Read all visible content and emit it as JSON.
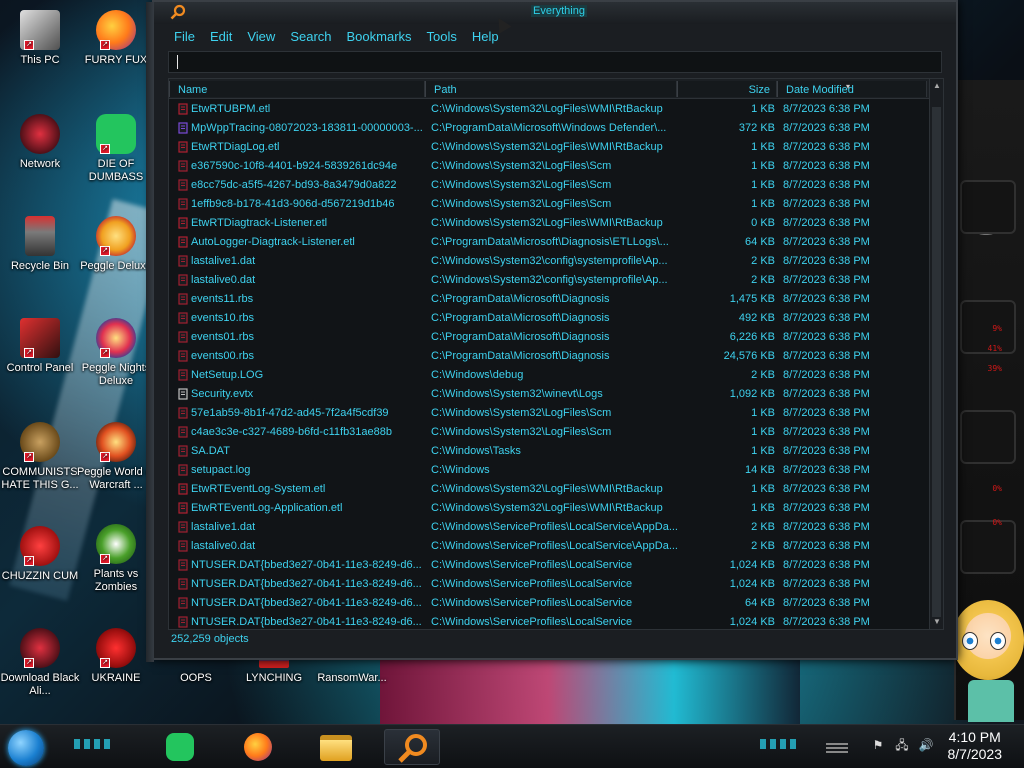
{
  "window": {
    "title": "Everything",
    "menu": [
      "File",
      "Edit",
      "View",
      "Search",
      "Bookmarks",
      "Tools",
      "Help"
    ],
    "search": {
      "value": "",
      "placeholder": ""
    },
    "columns": {
      "name": "Name",
      "path": "Path",
      "size": "Size",
      "date": "Date Modified"
    },
    "rows": [
      {
        "name": "EtwRTUBPM.etl",
        "path": "C:\\Windows\\System32\\LogFiles\\WMI\\RtBackup",
        "size": "1 KB",
        "date": "8/7/2023 6:38 PM",
        "icon": "etl-file-icon"
      },
      {
        "name": "MpWppTracing-08072023-183811-00000003-...",
        "path": "C:\\ProgramData\\Microsoft\\Windows Defender\\...",
        "size": "372 KB",
        "date": "8/7/2023 6:38 PM",
        "icon": "defender-file-icon"
      },
      {
        "name": "EtwRTDiagLog.etl",
        "path": "C:\\Windows\\System32\\LogFiles\\WMI\\RtBackup",
        "size": "1 KB",
        "date": "8/7/2023 6:38 PM",
        "icon": "etl-file-icon"
      },
      {
        "name": "e367590c-10f8-4401-b924-5839261dc94e",
        "path": "C:\\Windows\\System32\\LogFiles\\Scm",
        "size": "1 KB",
        "date": "8/7/2023 6:38 PM",
        "icon": "file-icon"
      },
      {
        "name": "e8cc75dc-a5f5-4267-bd93-8a3479d0a822",
        "path": "C:\\Windows\\System32\\LogFiles\\Scm",
        "size": "1 KB",
        "date": "8/7/2023 6:38 PM",
        "icon": "file-icon"
      },
      {
        "name": "1effb9c8-b178-41d3-906d-d567219d1b46",
        "path": "C:\\Windows\\System32\\LogFiles\\Scm",
        "size": "1 KB",
        "date": "8/7/2023 6:38 PM",
        "icon": "file-icon"
      },
      {
        "name": "EtwRTDiagtrack-Listener.etl",
        "path": "C:\\Windows\\System32\\LogFiles\\WMI\\RtBackup",
        "size": "0 KB",
        "date": "8/7/2023 6:38 PM",
        "icon": "etl-file-icon"
      },
      {
        "name": "AutoLogger-Diagtrack-Listener.etl",
        "path": "C:\\ProgramData\\Microsoft\\Diagnosis\\ETLLogs\\...",
        "size": "64 KB",
        "date": "8/7/2023 6:38 PM",
        "icon": "etl-file-icon"
      },
      {
        "name": "lastalive1.dat",
        "path": "C:\\Windows\\System32\\config\\systemprofile\\Ap...",
        "size": "2 KB",
        "date": "8/7/2023 6:38 PM",
        "icon": "file-icon"
      },
      {
        "name": "lastalive0.dat",
        "path": "C:\\Windows\\System32\\config\\systemprofile\\Ap...",
        "size": "2 KB",
        "date": "8/7/2023 6:38 PM",
        "icon": "file-icon"
      },
      {
        "name": "events11.rbs",
        "path": "C:\\ProgramData\\Microsoft\\Diagnosis",
        "size": "1,475 KB",
        "date": "8/7/2023 6:38 PM",
        "icon": "file-icon"
      },
      {
        "name": "events10.rbs",
        "path": "C:\\ProgramData\\Microsoft\\Diagnosis",
        "size": "492 KB",
        "date": "8/7/2023 6:38 PM",
        "icon": "file-icon"
      },
      {
        "name": "events01.rbs",
        "path": "C:\\ProgramData\\Microsoft\\Diagnosis",
        "size": "6,226 KB",
        "date": "8/7/2023 6:38 PM",
        "icon": "file-icon"
      },
      {
        "name": "events00.rbs",
        "path": "C:\\ProgramData\\Microsoft\\Diagnosis",
        "size": "24,576 KB",
        "date": "8/7/2023 6:38 PM",
        "icon": "file-icon"
      },
      {
        "name": "NetSetup.LOG",
        "path": "C:\\Windows\\debug",
        "size": "2 KB",
        "date": "8/7/2023 6:38 PM",
        "icon": "file-icon"
      },
      {
        "name": "Security.evtx",
        "path": "C:\\Windows\\System32\\winevt\\Logs",
        "size": "1,092 KB",
        "date": "8/7/2023 6:38 PM",
        "icon": "evtx-file-icon"
      },
      {
        "name": "57e1ab59-8b1f-47d2-ad45-7f2a4f5cdf39",
        "path": "C:\\Windows\\System32\\LogFiles\\Scm",
        "size": "1 KB",
        "date": "8/7/2023 6:38 PM",
        "icon": "file-icon"
      },
      {
        "name": "c4ae3c3e-c327-4689-b6fd-c11fb31ae88b",
        "path": "C:\\Windows\\System32\\LogFiles\\Scm",
        "size": "1 KB",
        "date": "8/7/2023 6:38 PM",
        "icon": "file-icon"
      },
      {
        "name": "SA.DAT",
        "path": "C:\\Windows\\Tasks",
        "size": "1 KB",
        "date": "8/7/2023 6:38 PM",
        "icon": "file-icon"
      },
      {
        "name": "setupact.log",
        "path": "C:\\Windows",
        "size": "14 KB",
        "date": "8/7/2023 6:38 PM",
        "icon": "file-icon"
      },
      {
        "name": "EtwRTEventLog-System.etl",
        "path": "C:\\Windows\\System32\\LogFiles\\WMI\\RtBackup",
        "size": "1 KB",
        "date": "8/7/2023 6:38 PM",
        "icon": "etl-file-icon"
      },
      {
        "name": "EtwRTEventLog-Application.etl",
        "path": "C:\\Windows\\System32\\LogFiles\\WMI\\RtBackup",
        "size": "1 KB",
        "date": "8/7/2023 6:38 PM",
        "icon": "etl-file-icon"
      },
      {
        "name": "lastalive1.dat",
        "path": "C:\\Windows\\ServiceProfiles\\LocalService\\AppDa...",
        "size": "2 KB",
        "date": "8/7/2023 6:38 PM",
        "icon": "file-icon"
      },
      {
        "name": "lastalive0.dat",
        "path": "C:\\Windows\\ServiceProfiles\\LocalService\\AppDa...",
        "size": "2 KB",
        "date": "8/7/2023 6:38 PM",
        "icon": "file-icon"
      },
      {
        "name": "NTUSER.DAT{bbed3e27-0b41-11e3-8249-d6...",
        "path": "C:\\Windows\\ServiceProfiles\\LocalService",
        "size": "1,024 KB",
        "date": "8/7/2023 6:38 PM",
        "icon": "file-icon"
      },
      {
        "name": "NTUSER.DAT{bbed3e27-0b41-11e3-8249-d6...",
        "path": "C:\\Windows\\ServiceProfiles\\LocalService",
        "size": "1,024 KB",
        "date": "8/7/2023 6:38 PM",
        "icon": "file-icon"
      },
      {
        "name": "NTUSER.DAT{bbed3e27-0b41-11e3-8249-d6...",
        "path": "C:\\Windows\\ServiceProfiles\\LocalService",
        "size": "64 KB",
        "date": "8/7/2023 6:38 PM",
        "icon": "file-icon"
      },
      {
        "name": "NTUSER.DAT{bbed3e27-0b41-11e3-8249-d6...",
        "path": "C:\\Windows\\ServiceProfiles\\LocalService",
        "size": "1,024 KB",
        "date": "8/7/2023 6:38 PM",
        "icon": "file-icon"
      }
    ],
    "status": "252,259 objects"
  },
  "desktop": {
    "left_icons": [
      {
        "label": "This PC",
        "icon": "this-pc-icon",
        "color": "#c0c0c0"
      },
      {
        "label": "Network",
        "icon": "network-icon",
        "color": "#b0202a"
      },
      {
        "label": "Recycle Bin",
        "icon": "recycle-bin-icon",
        "color": "#c02020"
      },
      {
        "label": "Control Panel",
        "icon": "control-panel-icon",
        "color": "#a01020"
      },
      {
        "label": "COMMUNISTS HATE THIS G...",
        "icon": "money-bag-icon",
        "color": "#8a6a2a"
      },
      {
        "label": "CHUZZIN CUM",
        "icon": "chuzzle-icon",
        "color": "#e02020"
      },
      {
        "label": "Download Black Ali...",
        "icon": "alienware-icon",
        "color": "#b0202a"
      }
    ],
    "second_icons": [
      {
        "label": "FURRY FUX",
        "icon": "firefox-icon",
        "color": "#ff7a1a"
      },
      {
        "label": "DIE OF DUMBASS",
        "icon": "discord-icon",
        "color": "#23c55e"
      },
      {
        "label": "Peggle Deluxe",
        "icon": "peggle-icon",
        "color": "#f0a020"
      },
      {
        "label": "Peggle Nights Deluxe",
        "icon": "peggle-nights-icon",
        "color": "#e03050"
      },
      {
        "label": "Peggle World of Warcraft ...",
        "icon": "peggle-wow-icon",
        "color": "#e05020"
      },
      {
        "label": "Plants vs Zombies",
        "icon": "pvz-icon",
        "color": "#4aa02a"
      },
      {
        "label": "UKRAINE",
        "icon": "radiation-icon",
        "color": "#d02020"
      }
    ],
    "bottom_icons": [
      {
        "label": "OOPS"
      },
      {
        "label": "LYNCHING"
      },
      {
        "label": "RansomWar..."
      }
    ],
    "wallpaper_red_text": [
      "9%",
      "41%",
      "39%",
      "0%",
      "0%"
    ]
  },
  "taskbar": {
    "apps": [
      {
        "name": "discord",
        "icon": "discord-icon",
        "color": "#23c55e"
      },
      {
        "name": "firefox",
        "icon": "firefox-icon",
        "color": "#ff7a1a"
      },
      {
        "name": "explorer",
        "icon": "folder-icon",
        "color": "#f0c040"
      },
      {
        "name": "everything",
        "icon": "magnifier-icon",
        "color": "#f08a20"
      }
    ],
    "time": "4:10 PM",
    "date": "8/7/2023"
  },
  "colors": {
    "accent": "#3ed2ef",
    "window_bg": "#1b1e22",
    "list_bg": "#111417"
  }
}
